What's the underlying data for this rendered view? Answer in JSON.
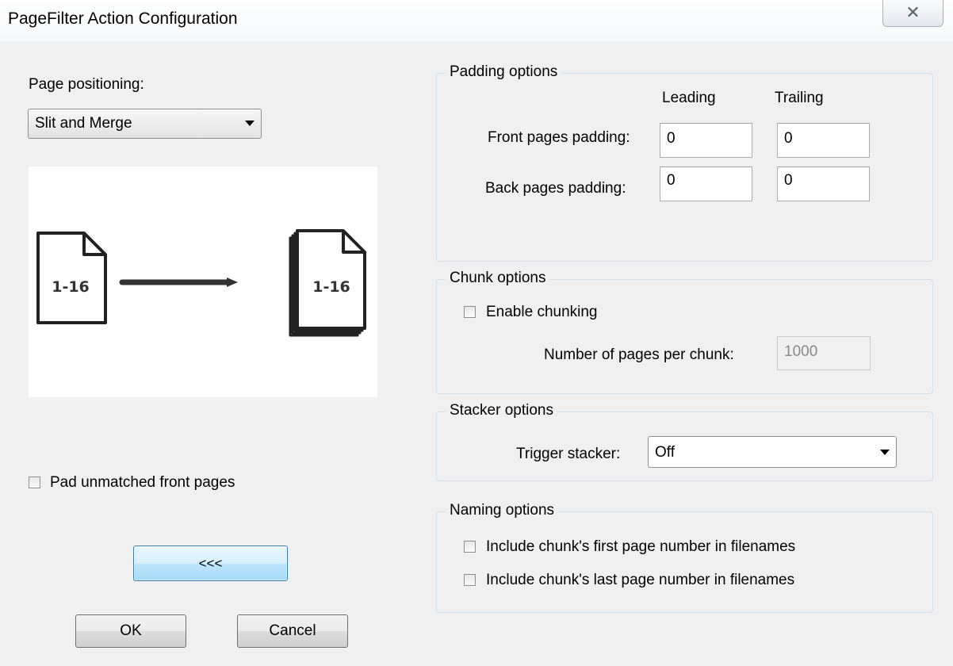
{
  "window": {
    "title": "PageFilter Action Configuration",
    "close_glyph": "✕"
  },
  "left": {
    "page_positioning_label": "Page positioning:",
    "page_positioning_value": "Slit and Merge",
    "preview": {
      "source_label": "1-16",
      "target_label": "1-16"
    },
    "pad_unmatched_label": "Pad unmatched front pages",
    "pad_unmatched_checked": false,
    "collapse_button_label": "<<<",
    "ok_label": "OK",
    "cancel_label": "Cancel"
  },
  "padding": {
    "title": "Padding options",
    "leading_header": "Leading",
    "trailing_header": "Trailing",
    "front_label": "Front pages padding:",
    "back_label": "Back pages padding:",
    "front_leading": "0",
    "front_trailing": "0",
    "back_leading": "0",
    "back_trailing": "0"
  },
  "chunk": {
    "title": "Chunk options",
    "enable_label": "Enable chunking",
    "enable_checked": false,
    "pages_per_chunk_label": "Number of pages per chunk:",
    "pages_per_chunk_value": "1000"
  },
  "stacker": {
    "title": "Stacker options",
    "trigger_label": "Trigger stacker:",
    "trigger_value": "Off"
  },
  "naming": {
    "title": "Naming options",
    "first_page_label": "Include chunk's first page number in filenames",
    "last_page_label": "Include chunk's last page number in filenames",
    "first_page_checked": false,
    "last_page_checked": false
  }
}
